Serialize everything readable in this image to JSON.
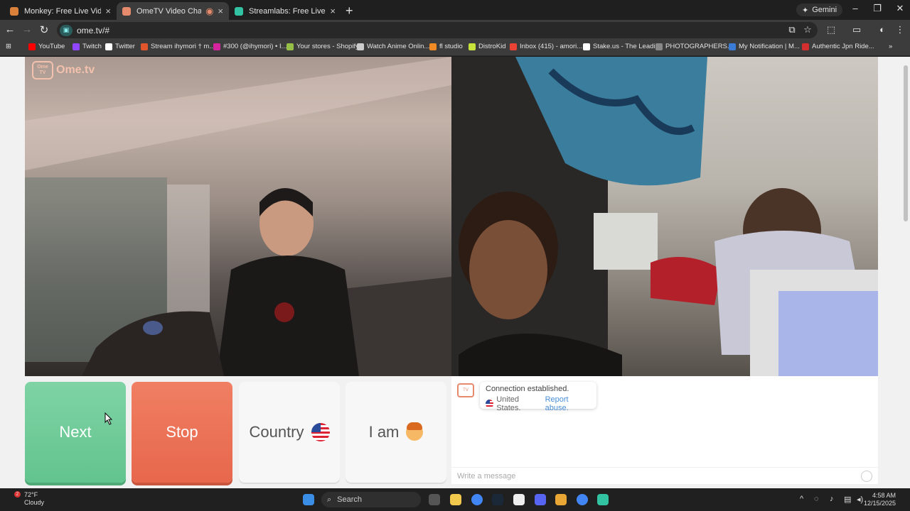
{
  "tabs": [
    {
      "title": "Monkey: Free Live Video Chat",
      "active": false,
      "fav_color": "#d9803a"
    },
    {
      "title": "OmeTV Video Chat — Ome",
      "active": true,
      "fav_color": "#e58a6c"
    },
    {
      "title": "Streamlabs: Free Live Streaming",
      "active": false,
      "fav_color": "#31c3a2"
    }
  ],
  "gemini_label": "Gemini",
  "address": "ome.tv/#",
  "bookmarks": [
    {
      "label": "YouTube",
      "color": "#ff0000"
    },
    {
      "label": "Twitch",
      "color": "#9146ff"
    },
    {
      "label": "Twitter",
      "color": "#ffffff"
    },
    {
      "label": "Stream ihymori † m...",
      "color": "#e0552b"
    },
    {
      "label": "#300 (@ihymori) • I...",
      "color": "#d6249f"
    },
    {
      "label": "Your stores - Shopify",
      "color": "#95bf47"
    },
    {
      "label": "Watch Anime Onlin...",
      "color": "#cccccc"
    },
    {
      "label": "fl studio",
      "color": "#f08a24"
    },
    {
      "label": "DistroKid",
      "color": "#c7e33b"
    },
    {
      "label": "Inbox (415) - amori...",
      "color": "#ea4335"
    },
    {
      "label": "Stake.us - The Leadi...",
      "color": "#ffffff"
    },
    {
      "label": "PHOTOGRAPHERS...",
      "color": "#888888"
    },
    {
      "label": "My Notification | M...",
      "color": "#3a7bd5"
    },
    {
      "label": "Authentic Jpn Ride...",
      "color": "#d32f2f"
    }
  ],
  "logo_text": "Ome.tv",
  "logo_badge": "Ome TV",
  "controls": {
    "next": "Next",
    "stop": "Stop",
    "country": "Country",
    "iam": "I am"
  },
  "chat": {
    "status": "Connection established.",
    "country": "United States.",
    "report": "Report abuse.",
    "placeholder": "Write a message"
  },
  "taskbar": {
    "weather_temp": "72°F",
    "weather_desc": "Cloudy",
    "notification_count": "2",
    "search_label": "Search",
    "time": "4:58 AM",
    "date": "12/15/2025"
  }
}
